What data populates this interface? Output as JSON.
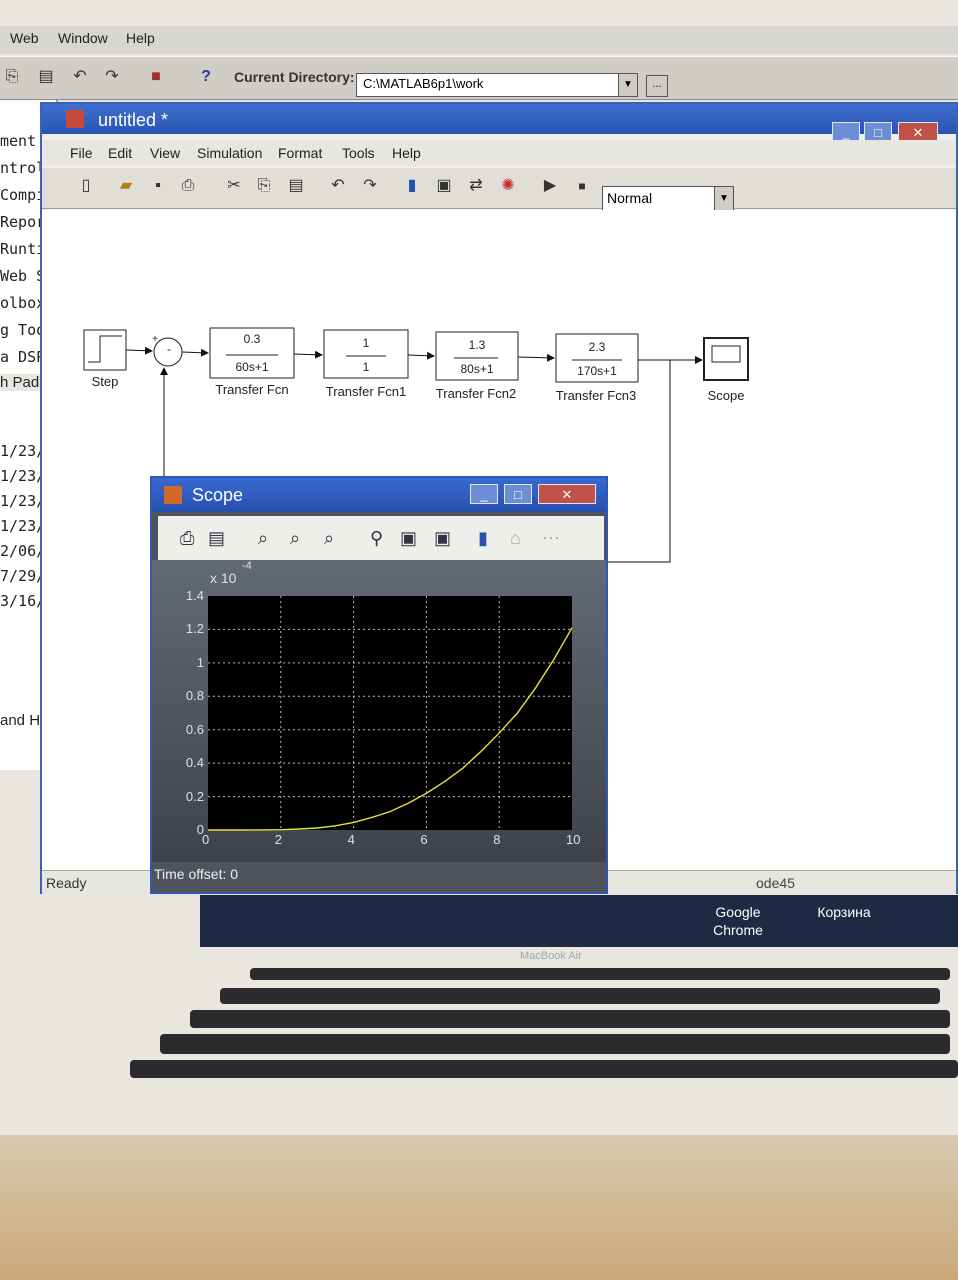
{
  "matlab": {
    "menu": [
      "Web",
      "Window",
      "Help"
    ],
    "current_directory_label": "Current Directory:",
    "current_directory_value": "C:\\MATLAB6p1\\work",
    "left_panel_lines": [
      "ment C",
      "ntrol",
      " Compi",
      " Repor",
      " Runti",
      " Web S",
      "olbox",
      "g Tool",
      "a DSP"
    ],
    "left_panel_tab": "h Pad",
    "left_panel_dates": [
      "1/23/",
      "1/23/",
      "1/23/",
      "1/23/",
      "2/06/",
      "7/29/",
      "3/16/"
    ],
    "left_panel_bottom": "and H"
  },
  "simulink": {
    "title": "untitled *",
    "menu": [
      "File",
      "Edit",
      "View",
      "Simulation",
      "Format",
      "Tools",
      "Help"
    ],
    "mode": "Normal",
    "status": "Ready",
    "solver": "ode45",
    "blocks": {
      "step": "Step",
      "sum_plus": "+",
      "sum_minus": "-",
      "tf1": {
        "num": "0.3",
        "den": "60s+1",
        "label": "Transfer Fcn"
      },
      "tf2": {
        "num": "1",
        "den": "1",
        "label": "Transfer Fcn1"
      },
      "tf3": {
        "num": "1.3",
        "den": "80s+1",
        "label": "Transfer Fcn2"
      },
      "tf4": {
        "num": "2.3",
        "den": "170s+1",
        "label": "Transfer Fcn3"
      },
      "scope": "Scope"
    }
  },
  "scope": {
    "title": "Scope",
    "time_offset_label": "Time offset:",
    "time_offset_value": "0",
    "y_multiplier": "x 10",
    "y_exponent": "-4",
    "line_color": "#e6e03a"
  },
  "chart_data": {
    "type": "line",
    "xlim": [
      0,
      10
    ],
    "ylim": [
      0,
      1.4
    ],
    "xticks": [
      "0",
      "2",
      "4",
      "6",
      "8",
      "10"
    ],
    "yticks": [
      "0",
      "0.2",
      "0.4",
      "0.6",
      "0.8",
      "1",
      "1.2",
      "1.4"
    ],
    "grid": true,
    "series": [
      {
        "x": [
          0,
          1,
          2,
          2.5,
          3,
          3.5,
          4,
          4.5,
          5,
          5.5,
          6,
          6.5,
          7,
          7.5,
          8,
          8.5,
          9,
          9.5,
          10
        ],
        "y": [
          0,
          0.0,
          0.002,
          0.006,
          0.012,
          0.025,
          0.045,
          0.075,
          0.11,
          0.16,
          0.22,
          0.29,
          0.37,
          0.47,
          0.58,
          0.7,
          0.85,
          1.02,
          1.21
        ]
      }
    ]
  },
  "dock": {
    "items": [
      "Google\nChrome",
      "Корзина"
    ],
    "laptop_label": "MacBook Air"
  }
}
